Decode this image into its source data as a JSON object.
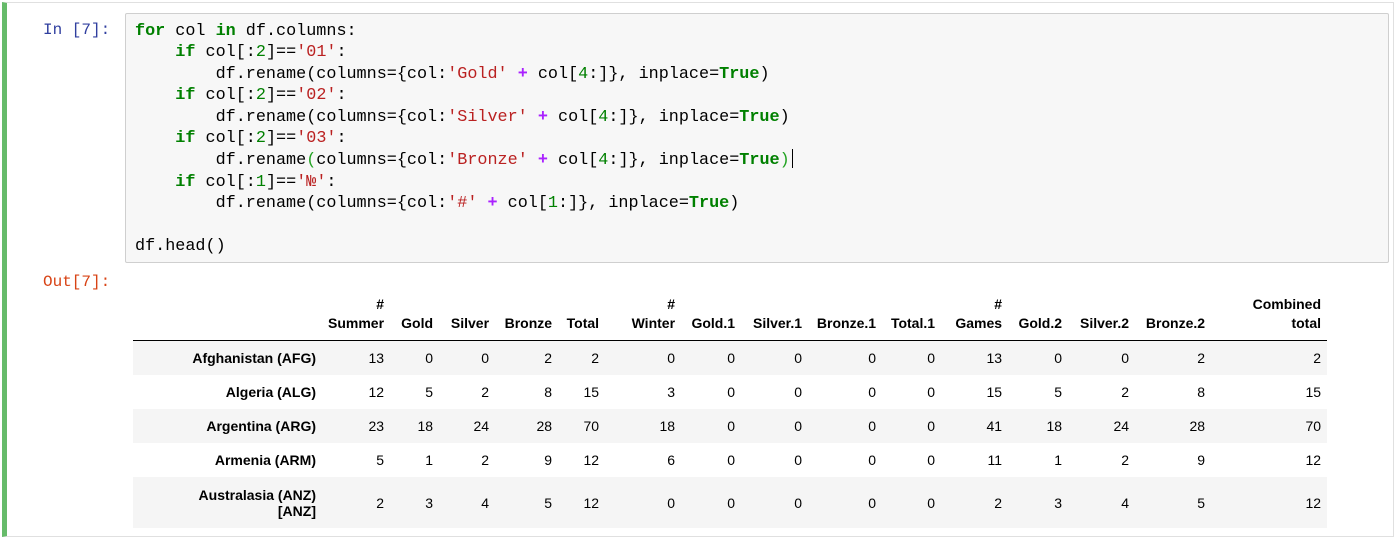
{
  "cell": {
    "input_prompt": "In [7]:",
    "output_prompt": "Out[7]:",
    "code_lines": [
      "for col in df.columns:",
      "    if col[:2]=='01':",
      "        df.rename(columns={col:'Gold' + col[4:]}, inplace=True)",
      "    if col[:2]=='02':",
      "        df.rename(columns={col:'Silver' + col[4:]}, inplace=True)",
      "    if col[:2]=='03':",
      "        df.rename(columns={col:'Bronze' + col[4:]}, inplace=True)",
      "    if col[:1]=='№':",
      "        df.rename(columns={col:'#' + col[1:]}, inplace=True)",
      "",
      "df.head()"
    ]
  },
  "table": {
    "columns": [
      [
        "#",
        "Summer"
      ],
      [
        "Gold"
      ],
      [
        "Silver"
      ],
      [
        "Bronze"
      ],
      [
        "Total"
      ],
      [
        "#",
        "Winter"
      ],
      [
        "Gold.1"
      ],
      [
        "Silver.1"
      ],
      [
        "Bronze.1"
      ],
      [
        "Total.1"
      ],
      [
        "#",
        "Games"
      ],
      [
        "Gold.2"
      ],
      [
        "Silver.2"
      ],
      [
        "Bronze.2"
      ],
      [
        "Combined",
        "total"
      ]
    ],
    "rows": [
      {
        "index": [
          "Afghanistan (AFG)"
        ],
        "values": [
          13,
          0,
          0,
          2,
          2,
          0,
          0,
          0,
          0,
          0,
          13,
          0,
          0,
          2,
          2
        ]
      },
      {
        "index": [
          "Algeria (ALG)"
        ],
        "values": [
          12,
          5,
          2,
          8,
          15,
          3,
          0,
          0,
          0,
          0,
          15,
          5,
          2,
          8,
          15
        ]
      },
      {
        "index": [
          "Argentina (ARG)"
        ],
        "values": [
          23,
          18,
          24,
          28,
          70,
          18,
          0,
          0,
          0,
          0,
          41,
          18,
          24,
          28,
          70
        ]
      },
      {
        "index": [
          "Armenia (ARM)"
        ],
        "values": [
          5,
          1,
          2,
          9,
          12,
          6,
          0,
          0,
          0,
          0,
          11,
          1,
          2,
          9,
          12
        ]
      },
      {
        "index": [
          "Australasia (ANZ)",
          "[ANZ]"
        ],
        "values": [
          2,
          3,
          4,
          5,
          12,
          0,
          0,
          0,
          0,
          0,
          2,
          3,
          4,
          5,
          12
        ]
      }
    ]
  },
  "colors": {
    "cell_border_active": "#66bb6a",
    "input_prompt": "#303f9f",
    "output_prompt": "#d84315",
    "keyword": "#008000",
    "string": "#ba2121",
    "operator": "#aa22ff"
  }
}
